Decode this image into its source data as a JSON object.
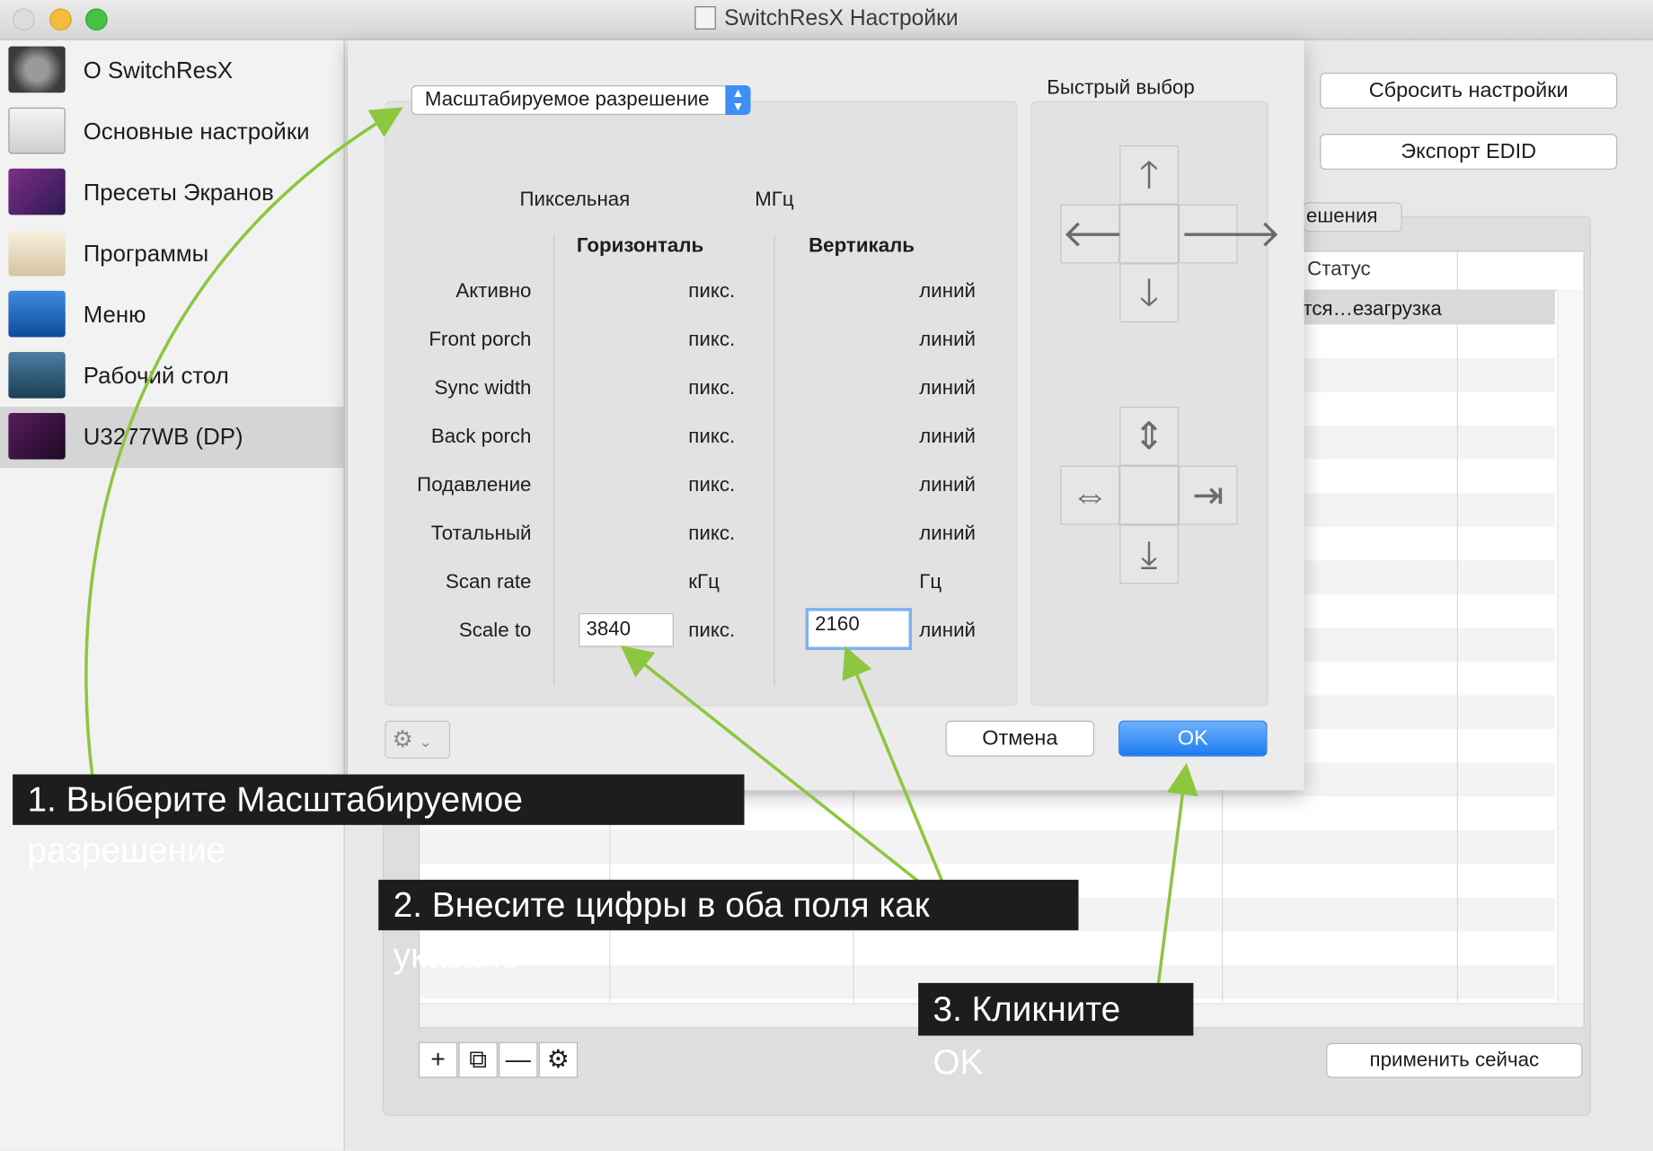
{
  "window": {
    "title": "SwitchResX Настройки"
  },
  "sidebar": {
    "items": [
      {
        "label": "О SwitchResX",
        "icon": "switchresx-gear-icon"
      },
      {
        "label": "Основные настройки",
        "icon": "light-switch-icon"
      },
      {
        "label": "Пресеты Экранов",
        "icon": "display-presets-icon"
      },
      {
        "label": "Программы",
        "icon": "applications-icon"
      },
      {
        "label": "Меню",
        "icon": "menu-screenshot-icon"
      },
      {
        "label": "Рабочий стол",
        "icon": "desktop-icon"
      },
      {
        "label": "U3277WB (DP)",
        "icon": "monitor-icon",
        "selected": true
      }
    ]
  },
  "main": {
    "reset_button": "Сбросить настройки",
    "export_button": "Экспорт EDID",
    "tab_fragment": "ешения",
    "table": {
      "status_header": "Статус",
      "row1_status": "тся…езагрузка"
    },
    "apply_button": "применить сейчас",
    "toolbar": {
      "add": "+",
      "duplicate": "⧉",
      "remove": "—",
      "settings": "⚙"
    }
  },
  "dialog": {
    "resolution_type": "Масштабируемое разрешение",
    "pixel_clock_label": "Пиксельная",
    "pixel_clock_unit": "МГц",
    "col_horizontal": "Горизонталь",
    "col_vertical": "Вертикаль",
    "rows": [
      {
        "label": "Активно",
        "h_unit": "пикс.",
        "v_unit": "линий"
      },
      {
        "label": "Front porch",
        "h_unit": "пикс.",
        "v_unit": "линий"
      },
      {
        "label": "Sync width",
        "h_unit": "пикс.",
        "v_unit": "линий"
      },
      {
        "label": "Back porch",
        "h_unit": "пикс.",
        "v_unit": "линий"
      },
      {
        "label": "Подавление",
        "h_unit": "пикс.",
        "v_unit": "линий"
      },
      {
        "label": "Тотальный",
        "h_unit": "пикс.",
        "v_unit": "линий"
      },
      {
        "label": "Scan rate",
        "h_unit": "кГц",
        "v_unit": "Гц"
      },
      {
        "label": "Scale to",
        "h_unit": "пикс.",
        "v_unit": "линий"
      }
    ],
    "scale_h_value": "3840",
    "scale_v_value": "2160",
    "quick_select_label": "Быстрый выбор",
    "cancel_button": "Отмена",
    "ok_button": "OK"
  },
  "annotations": {
    "step1": "1. Выберите Масштабируемое разрешение",
    "step2": "2. Внесите цифры в оба поля как указано",
    "step3": "3. Кликните OK",
    "arrow_color": "#8dc63f"
  },
  "colors": {
    "accent": "#1d7cf2",
    "selection": "#d5d5d5"
  }
}
